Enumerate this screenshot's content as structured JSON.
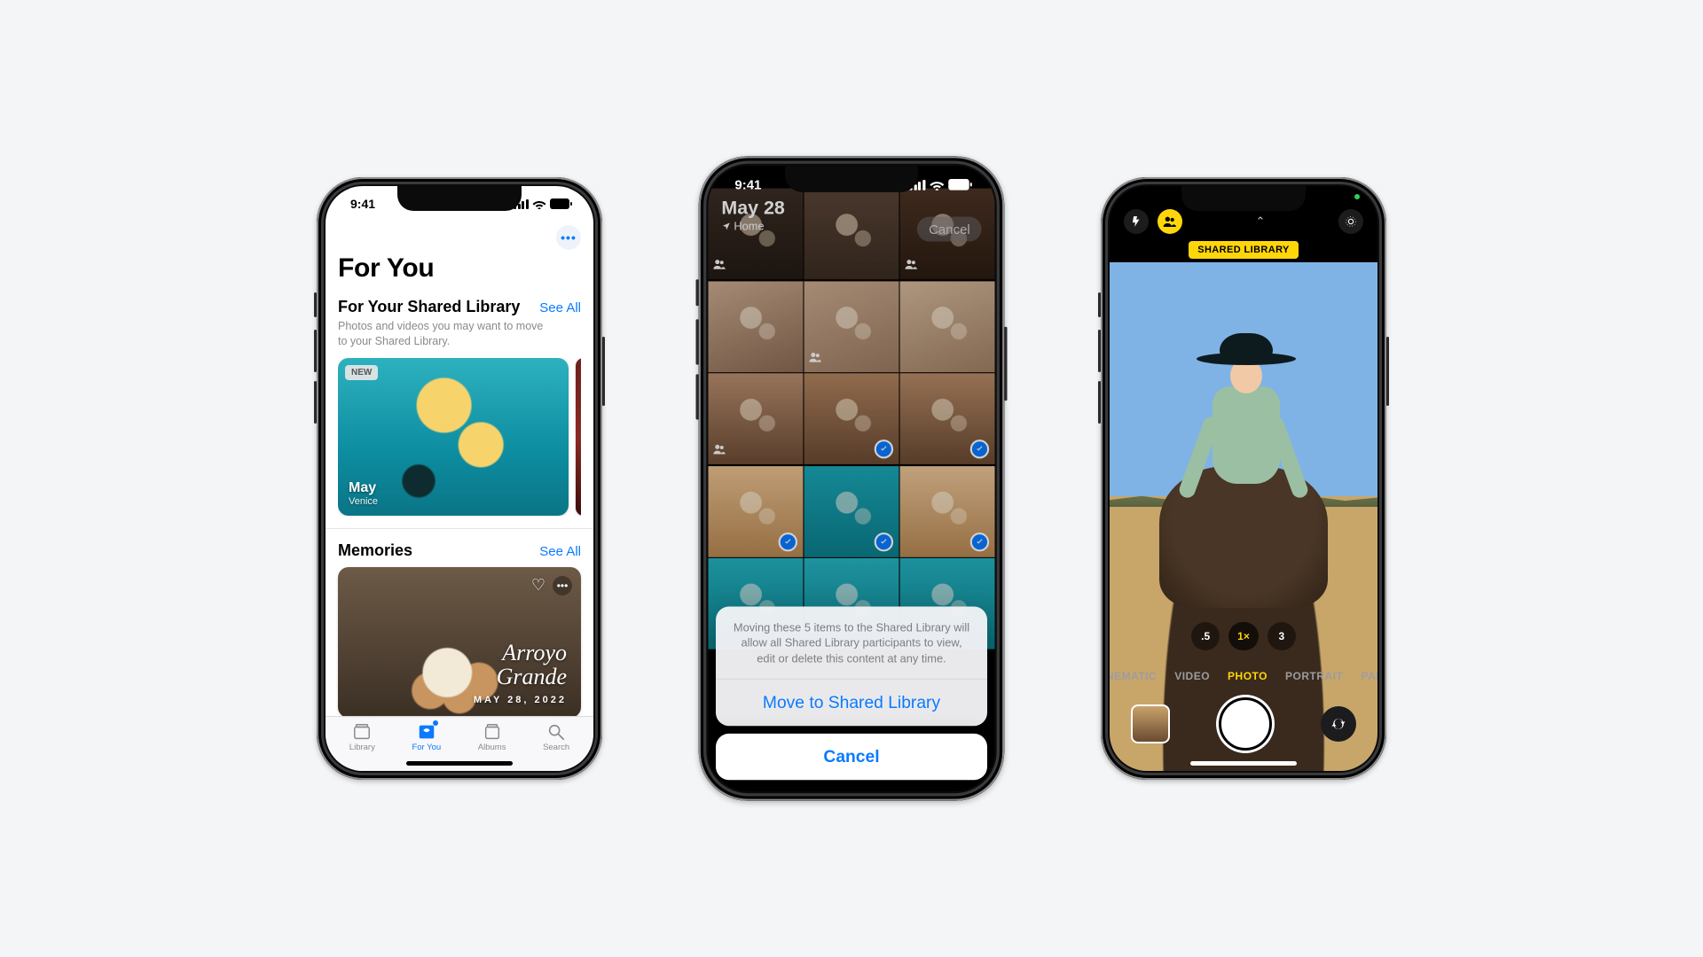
{
  "status": {
    "time": "9:41"
  },
  "phone1": {
    "page_title": "For You",
    "shared": {
      "title": "For Your Shared Library",
      "see_all": "See All",
      "description": "Photos and videos you may want to move to your Shared Library.",
      "card": {
        "badge": "NEW",
        "title": "May",
        "subtitle": "Venice"
      }
    },
    "memories": {
      "title": "Memories",
      "see_all": "See All",
      "card": {
        "title_line1": "Arroyo",
        "title_line2": "Grande",
        "date": "MAY 28, 2022"
      }
    },
    "tabs": {
      "library": "Library",
      "for_you": "For You",
      "albums": "Albums",
      "search": "Search"
    }
  },
  "phone2": {
    "header": {
      "date": "May 28",
      "location": "Home",
      "cancel": "Cancel"
    },
    "grid": {
      "cells": [
        {
          "shared": true,
          "selected": false
        },
        {
          "shared": false,
          "selected": false
        },
        {
          "shared": true,
          "selected": false
        },
        {
          "shared": false,
          "selected": false
        },
        {
          "shared": true,
          "selected": false
        },
        {
          "shared": false,
          "selected": false
        },
        {
          "shared": true,
          "selected": false
        },
        {
          "shared": false,
          "selected": true
        },
        {
          "shared": false,
          "selected": true
        },
        {
          "shared": false,
          "selected": true
        },
        {
          "shared": false,
          "selected": true
        },
        {
          "shared": false,
          "selected": true
        },
        {
          "shared": false,
          "selected": false
        },
        {
          "shared": false,
          "selected": false
        },
        {
          "shared": false,
          "selected": false
        }
      ]
    },
    "sheet": {
      "message": "Moving these 5 items to the Shared Library will allow all Shared Library participants to view, edit or delete this content at any time.",
      "action": "Move to Shared Library",
      "cancel": "Cancel"
    }
  },
  "phone3": {
    "label": "SHARED LIBRARY",
    "zooms": {
      "z1": ".5",
      "z2": "1×",
      "z3": "3"
    },
    "modes": {
      "cinematic": "CINEMATIC",
      "video": "VIDEO",
      "photo": "PHOTO",
      "portrait": "PORTRAIT",
      "pano": "PANO"
    }
  }
}
